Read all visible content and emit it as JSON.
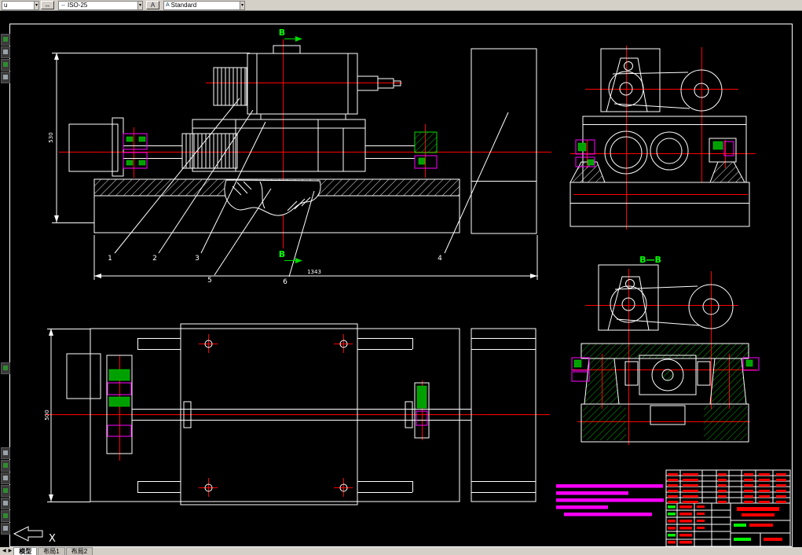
{
  "toolbar": {
    "layer_value": "u",
    "dim_style_value": "ISO-25",
    "text_style_value": "Standard",
    "arrow": "▾",
    "dim_icon": "↔",
    "text_icon": "A"
  },
  "sheet_tabs": {
    "prev": "◀",
    "next": "▶",
    "model": "模型",
    "layout1": "布局1",
    "layout2": "布局2"
  },
  "drawing": {
    "section_label": "B",
    "section_view_title": "B—B",
    "balloons": [
      "1",
      "2",
      "3",
      "4",
      "5",
      "6"
    ],
    "dims": {
      "overall": "1343",
      "height": "530",
      "width": "500"
    },
    "ucs_x": "X"
  },
  "colors": {
    "entity": "#ffffff",
    "centerline": "#ff0000",
    "section_green": "#00ff00",
    "detail_magenta": "#ff00ff",
    "toolbar_bg": "#d4d0c8",
    "canvas_bg": "#000000",
    "titleblock_text": "#ff0000"
  }
}
